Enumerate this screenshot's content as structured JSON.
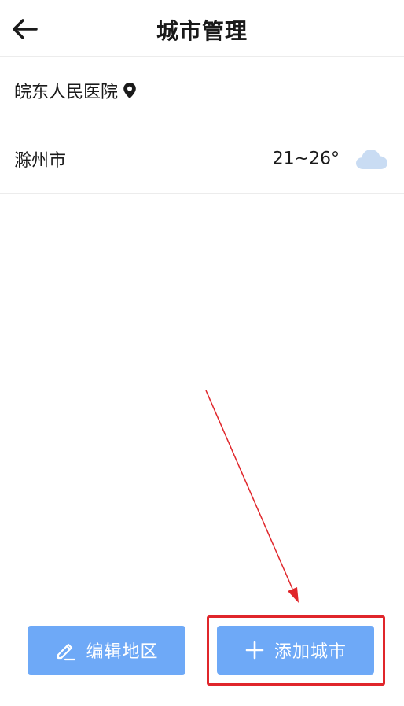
{
  "header": {
    "back_icon": "arrow-left-icon",
    "title": "城市管理"
  },
  "location_row": {
    "name": "皖东人民医院",
    "icon": "location-pin-icon"
  },
  "city_row": {
    "name": "滁州市",
    "temperature": "21~26°",
    "weather_icon": "cloud-icon"
  },
  "buttons": {
    "edit_label": "编辑地区",
    "edit_icon": "pencil-icon",
    "add_label": "添加城市",
    "add_icon": "plus-icon"
  },
  "annotation": {
    "highlight_color": "#e0262b"
  },
  "colors": {
    "button_bg": "#6ea9f7",
    "weather_icon": "#c9dcf3"
  }
}
